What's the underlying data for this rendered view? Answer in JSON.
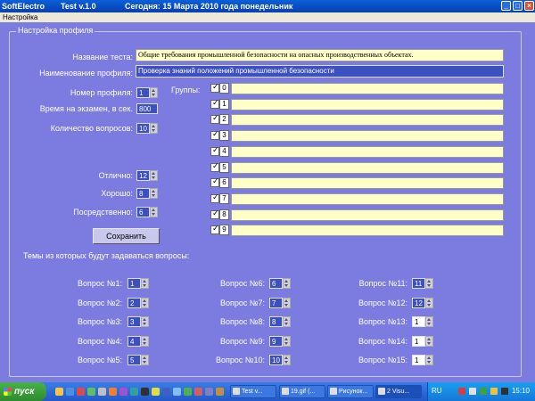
{
  "window": {
    "app_name": "SoftElectro",
    "version": "Test v.1.0",
    "date_text": "Сегодня: 15 Марта 2010 года понедельник"
  },
  "menu": {
    "settings": "Настройка"
  },
  "profile": {
    "group_title": "Настройка профиля",
    "test_name_label": "Название теста:",
    "test_name_value": "Общие требования промышленной безопасности на опасных производственных объектах.",
    "profile_name_label": "Наименование профиля:",
    "profile_name_value": "Проверка знаний положений промышленной безопасности",
    "profile_number_label": "Номер профиля:",
    "profile_number_value": "1",
    "exam_time_label": "Время на экзамен, в сек.",
    "exam_time_value": "800",
    "question_count_label": "Количество вопросов:",
    "question_count_value": "10",
    "groups_label": "Группы:",
    "groups": [
      "0",
      "1",
      "2",
      "3",
      "4",
      "5",
      "6",
      "7",
      "8",
      "9"
    ],
    "excellent_label": "Отлично:",
    "excellent_value": "12",
    "good_label": "Хорошо:",
    "good_value": "8",
    "satisfactory_label": "Посредственно:",
    "satisfactory_value": "6",
    "save_label": "Сохранить",
    "topics_label": "Темы из которых будут задаваться вопросы:"
  },
  "questions": [
    {
      "label": "Вопрос №1:",
      "value": "1"
    },
    {
      "label": "Вопрос №2:",
      "value": "2"
    },
    {
      "label": "Вопрос №3:",
      "value": "3"
    },
    {
      "label": "Вопрос №4:",
      "value": "4"
    },
    {
      "label": "Вопрос №5:",
      "value": "5"
    },
    {
      "label": "Вопрос №6:",
      "value": "6"
    },
    {
      "label": "Вопрос №7:",
      "value": "7"
    },
    {
      "label": "Вопрос №8:",
      "value": "8"
    },
    {
      "label": "Вопрос №9:",
      "value": "9"
    },
    {
      "label": "Вопрос №10:",
      "value": "10"
    },
    {
      "label": "Вопрос №11:",
      "value": "11"
    },
    {
      "label": "Вопрос №12:",
      "value": "12"
    },
    {
      "label": "Вопрос №13:",
      "value": "1"
    },
    {
      "label": "Вопрос №14:",
      "value": "1"
    },
    {
      "label": "Вопрос №15:",
      "value": "1"
    }
  ],
  "taskbar": {
    "start_label": "пуск",
    "tasks": [
      "Test v...",
      "19.gif (...",
      "Рисунок...",
      "2 Visu..."
    ],
    "lang": "RU",
    "clock": "15:10"
  },
  "colors": {
    "background": "#7b7be0",
    "field_yellow": "#ffffc8",
    "field_blue": "#3c50c0",
    "titlebar": "#0a5fd8",
    "taskbar": "#2358c8"
  }
}
